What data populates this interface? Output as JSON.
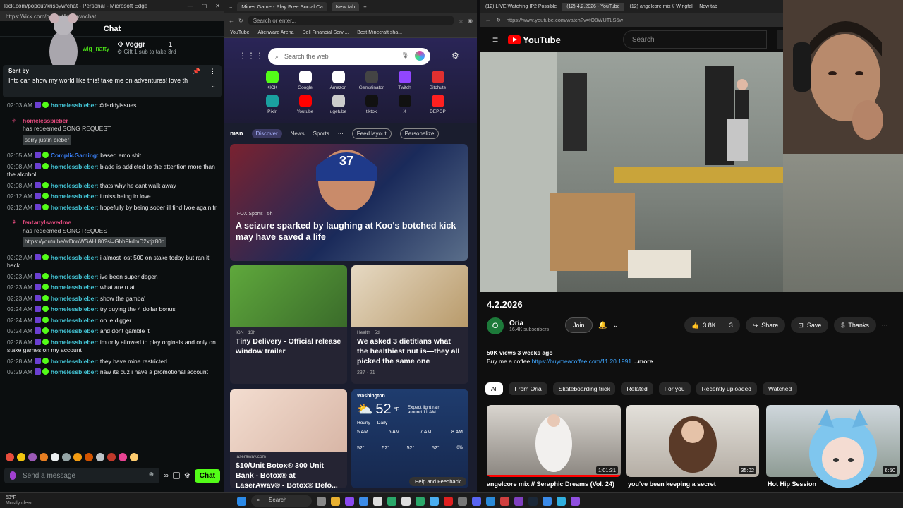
{
  "chat": {
    "window_title": "kick.com/popout/krispyw/chat - Personal - Microsoft Edge",
    "url": "https://kick.com/popout/krispyw/chat",
    "header": "Chat",
    "gift": {
      "user": "Voggr",
      "count": "1",
      "gifter": "wig_natty",
      "note": "Gift 1 sub to take 3rd"
    },
    "pinned": {
      "label": "Sent by",
      "text": "Ihtc can show my world like this! take me on adventures! love th",
      "time": "02:03 AM",
      "user": "homelessbieber",
      "msg": "#daddyissues"
    },
    "messages": [
      {
        "type": "redeem",
        "user": "homelessbieber",
        "text": "has redeemed SONG REQUEST",
        "extra": "sorry justin bieber"
      },
      {
        "time": "02:05 AM",
        "user": "ComplicGaming:",
        "text": " based emo shit",
        "alt": true
      },
      {
        "time": "02:08 AM",
        "user": "homelessbieber:",
        "text": " blade is addicted to the attention more than the alcohol"
      },
      {
        "time": "02:08 AM",
        "user": "homelessbieber:",
        "text": " thats why he cant walk away"
      },
      {
        "time": "02:12 AM",
        "user": "homelessbieber:",
        "text": " i miss being in love"
      },
      {
        "time": "02:12 AM",
        "user": "homelessbieber:",
        "text": " hopefully by being sober ill find lvoe again fr"
      },
      {
        "type": "redeem",
        "user": "fentanylsavedme",
        "text": "has redeemed SONG REQUEST",
        "extra": "https://youtu.be/wDnnWSAHI80?si=GbhFkdmD2xtjz80p"
      },
      {
        "time": "02:22 AM",
        "user": "homelessbieber:",
        "text": " i almost lost 500 on stake today but ran it back"
      },
      {
        "time": "02:23 AM",
        "user": "homelessbieber:",
        "text": " ive been super degen"
      },
      {
        "time": "02:23 AM",
        "user": "homelessbieber:",
        "text": " what are u at"
      },
      {
        "time": "02:23 AM",
        "user": "homelessbieber:",
        "text": " show the gamba'"
      },
      {
        "time": "02:24 AM",
        "user": "homelessbieber:",
        "text": " try buying the 4 dollar bonus"
      },
      {
        "time": "02:24 AM",
        "user": "homelessbieber:",
        "text": " on le digger"
      },
      {
        "time": "02:24 AM",
        "user": "homelessbieber:",
        "text": " and dont gamble it"
      },
      {
        "time": "02:28 AM",
        "user": "homelessbieber:",
        "text": " im only allowed to play orginals and only on stake games on my account"
      },
      {
        "time": "02:28 AM",
        "user": "homelessbieber:",
        "text": " they have mine restricted"
      },
      {
        "time": "02:29 AM",
        "user": "homelessbieber:",
        "text": " naw its cuz i have a promotional account"
      }
    ],
    "send_placeholder": "Send a message",
    "send_button": "Chat"
  },
  "edge": {
    "tabs": [
      "Mines Game - Play Free Social Ca",
      "New tab"
    ],
    "address_placeholder": "Search or enter...",
    "favorites": [
      "YouTube",
      "Alienware Arena",
      "Dell Financial Servi...",
      "Best Minecraft sha..."
    ],
    "search_placeholder": "Search the web",
    "quick_links": [
      {
        "label": "KICK",
        "color": "#53fc18"
      },
      {
        "label": "Google",
        "color": "#ffffff"
      },
      {
        "label": "Amazon",
        "color": "#ffffff"
      },
      {
        "label": "Gemstinator",
        "color": "#444444"
      },
      {
        "label": "Twitch",
        "color": "#9146ff"
      },
      {
        "label": "Bitchute",
        "color": "#e03030"
      },
      {
        "label": "Pixlr",
        "color": "#1aa0a0"
      },
      {
        "label": "Youtube",
        "color": "#ff0000"
      },
      {
        "label": "ugetube",
        "color": "#cccccc"
      },
      {
        "label": "tiktok",
        "color": "#111111"
      },
      {
        "label": "X",
        "color": "#111111"
      },
      {
        "label": "DEPOP",
        "color": "#ff2020"
      }
    ],
    "msn": {
      "logo": "msn",
      "tabs": [
        "Discover",
        "News",
        "Sports"
      ],
      "feed_layout": "Feed layout",
      "personalize": "Personalize"
    },
    "hero": {
      "source": "FOX Sports · 5h",
      "title": "A seizure sparked by laughing at Koo's botched kick may have saved a life"
    },
    "cards": [
      {
        "source": "IGN · 13h",
        "title": "Tiny Delivery - Official release window trailer"
      },
      {
        "source": "Health · 5d",
        "title": "We asked 3 dietitians what the healthiest nut is—they all picked the same one",
        "meta": "237 · 21"
      },
      {
        "source": "laseraway.com",
        "title": "$10/Unit Botox® 300 Unit Bank - Botox® at LaserAway® - Botox® Befo..."
      }
    ],
    "weather": {
      "city": "Washington",
      "temp": "52",
      "unit": "°F",
      "note": "Expect light rain around 11 AM",
      "tabs": [
        "Hourly",
        "Daily"
      ],
      "hours": [
        "5 AM",
        "6 AM",
        "7 AM",
        "8 AM"
      ],
      "temps": [
        "52°",
        "52°",
        "52°",
        "52°"
      ],
      "precip": [
        "0%"
      ]
    },
    "help": "Help and Feedback"
  },
  "youtube": {
    "tabs": [
      "(12) LIVE Watching IP2 Possible",
      "(12) 4.2.2026 - YouTube",
      "(12) angelcore mix // Wingfall",
      "New tab"
    ],
    "url": "https://www.youtube.com/watch?v=fO8WUTLS5w",
    "logo": "YouTube",
    "search_placeholder": "Search",
    "video_title": "4.2.2026",
    "channel": {
      "name": "Oria",
      "subs": "16.4K subscribers",
      "initial": "O"
    },
    "join": "Join",
    "likes": "3.8K",
    "dislikes": "3",
    "share": "Share",
    "save": "Save",
    "thanks": "Thanks",
    "desc_stats": "50K views  3 weeks ago",
    "desc_text": "Buy me a coffee ",
    "desc_link": "https://buymeacoffee.com/11.20.1991",
    "more": "...more",
    "chips": [
      "All",
      "From Oria",
      "Skateboarding trick",
      "Related",
      "For you",
      "Recently uploaded",
      "Watched"
    ],
    "thumbs": [
      {
        "title": "angelcore mix // Seraphic Dreams (Vol. 24)",
        "duration": "1:01:31"
      },
      {
        "title": "you've been keeping a secret",
        "duration": "35:02"
      },
      {
        "title": "Hot Hip Session",
        "duration": "6:50"
      }
    ]
  },
  "taskbar": {
    "weather_temp": "53°F",
    "weather_desc": "Mostly clear",
    "search": "Search"
  }
}
